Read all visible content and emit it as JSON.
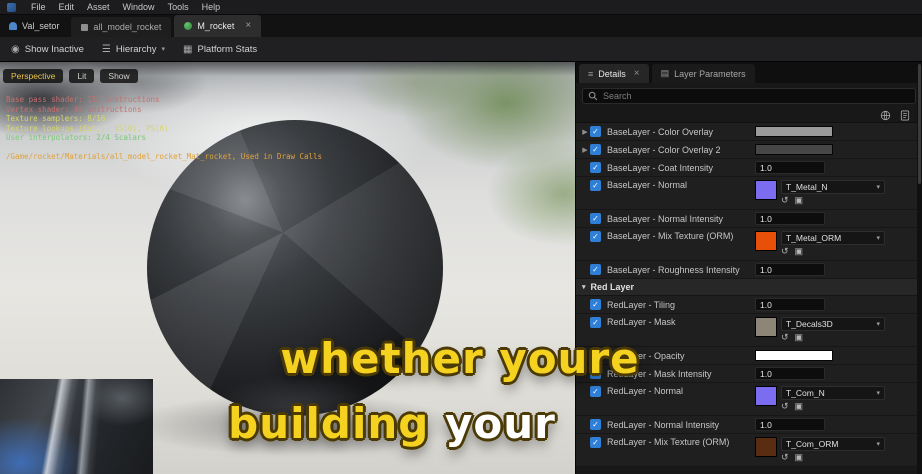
{
  "colors": {
    "accent_blue": "#2f7fd6",
    "caption_yellow": "#f4d21f",
    "caption_white": "#ffffff",
    "normal_purple": "#7b6cf0",
    "orm_orange": "#e8500a"
  },
  "menu": {
    "items": [
      "File",
      "Edit",
      "Asset",
      "Window",
      "Tools",
      "Help"
    ]
  },
  "tabbar": {
    "app_label": "Val_setor",
    "tabs": [
      {
        "label": "all_model_rocket",
        "active": false,
        "icon": "asset-icon"
      },
      {
        "label": "M_rocket",
        "active": true,
        "icon": "sphere-icon"
      }
    ]
  },
  "toolbar": {
    "buttons": [
      {
        "label": "Show Inactive",
        "icon": "eye-icon",
        "caret": false
      },
      {
        "label": "Hierarchy",
        "icon": "list-icon",
        "caret": true
      },
      {
        "label": "Platform Stats",
        "icon": "monitor-icon",
        "caret": false
      }
    ]
  },
  "viewport": {
    "overlay_buttons": [
      "Perspective",
      "Lit",
      "Show"
    ],
    "stats": [
      {
        "text": "Base pass shader: 152 instructions",
        "color": "#c87070",
        "gap": false
      },
      {
        "text": "Vertex shader: 49 instructions",
        "color": "#c87070",
        "gap": false
      },
      {
        "text": "Texture samplers: 8/16",
        "color": "#d6d66a",
        "gap": false
      },
      {
        "text": "Texture lookups (Est.): VS(0), PS(6)",
        "color": "#d6d66a",
        "gap": false
      },
      {
        "text": "User interpolators: 2/4 Scalars",
        "color": "#79c879",
        "gap": false
      },
      {
        "text": "/Game/rocket/Materials/all_model_rocket_Mat_rocket, Used in Draw Calls",
        "color": "#e0a23a",
        "gap": true
      }
    ],
    "caption": {
      "line1": "whether youre",
      "line2_yellow": "building ",
      "line2_white": "your"
    }
  },
  "panel": {
    "tabs": [
      {
        "label": "Details",
        "icon": "sliders-icon",
        "active": true,
        "closable": true
      },
      {
        "label": "Layer Parameters",
        "icon": "layers-icon",
        "active": false,
        "closable": false
      }
    ],
    "search_placeholder": "Search",
    "rows": [
      {
        "type": "color",
        "label": "BaseLayer - Color Overlay",
        "swatch": "#9a9a9a",
        "expandable": true,
        "checked": true
      },
      {
        "type": "color",
        "label": "BaseLayer - Color Overlay 2",
        "swatch": "#474747",
        "expandable": true,
        "checked": true
      },
      {
        "type": "number",
        "label": "BaseLayer - Coat Intensity",
        "value": "1.0",
        "checked": true
      },
      {
        "type": "texture",
        "label": "BaseLayer - Normal",
        "thumb": "#7b6cf0",
        "value": "T_Metal_N",
        "checked": true
      },
      {
        "type": "number",
        "label": "BaseLayer - Normal Intensity",
        "value": "1.0",
        "checked": true
      },
      {
        "type": "texture",
        "label": "BaseLayer - Mix Texture (ORM)",
        "thumb": "#e8500a",
        "value": "T_Metal_ORM",
        "checked": true
      },
      {
        "type": "number",
        "label": "BaseLayer - Roughness Intensity",
        "value": "1.0",
        "checked": true
      },
      {
        "type": "section",
        "label": "Red Layer"
      },
      {
        "type": "number",
        "label": "RedLayer - Tiling",
        "value": "1.0",
        "checked": true
      },
      {
        "type": "texture",
        "label": "RedLayer - Mask",
        "thumb": "#8d8578",
        "value": "T_Decals3D",
        "checked": true
      },
      {
        "type": "color",
        "label": "RedLayer - Opacity",
        "swatch": "#ffffff",
        "expandable": false,
        "checked": true
      },
      {
        "type": "number",
        "label": "RedLayer - Mask Intensity",
        "value": "1.0",
        "checked": true
      },
      {
        "type": "texture",
        "label": "RedLayer - Normal",
        "thumb": "#7b6cf0",
        "value": "T_Com_N",
        "checked": true
      },
      {
        "type": "number",
        "label": "RedLayer - Normal Intensity",
        "value": "1.0",
        "checked": true
      },
      {
        "type": "texture",
        "label": "RedLayer - Mix Texture (ORM)",
        "thumb": "#5a2d12",
        "value": "T_Com_ORM",
        "checked": true
      }
    ]
  }
}
